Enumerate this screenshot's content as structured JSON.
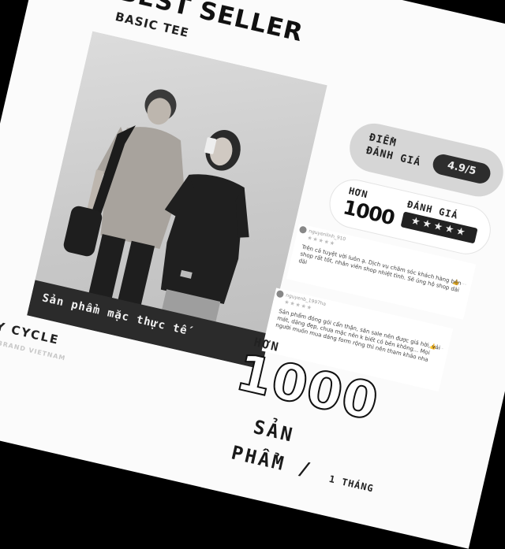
{
  "header": {
    "title": "BEST SELLER",
    "subtitle": "BASIC TEE"
  },
  "photo": {
    "caption": "Sản phẩm mặc thực tế"
  },
  "brand": {
    "name": "CITY CYCLE",
    "tagline": "LOCAL BRAND VIETNAM"
  },
  "rating": {
    "label_line1": "ĐIỂM",
    "label_line2": "ĐÁNH GIÁ",
    "score": "4.9/5"
  },
  "reviews_badge": {
    "prefix": "HƠN",
    "count": "1000",
    "label": "ĐÁNH GIÁ",
    "stars": "★★★★★"
  },
  "reviews": [
    {
      "user": "nguyenlinh_910",
      "stars": "★★★★★",
      "text": "Trên cả tuyệt vời luôn ạ. Dịch vụ chăm sóc khách hàng bên shop rất tốt, nhân viên shop nhiệt tình. Sẽ ủng hộ shop dài dài",
      "icons": "👍 ⋯"
    },
    {
      "user": "nguyenb_1997ha",
      "stars": "★★★★★",
      "text": "Sản phẩm đóng gói cẩn thận, săn sale nên được giá hời, vải mát, dáng đẹp, chưa mặc nên k biết có bền không... Mọi người muốn mua dáng form rộng thì nên tham khảo nha",
      "icons": "👍 ⋯"
    }
  ],
  "sales": {
    "prefix": "HƠN",
    "count": "1000",
    "unit_line1": "SẢN",
    "unit_line2": "PHẨM /",
    "period": "1 THÁNG"
  },
  "colors": {
    "background": "#fbfbfb",
    "dark": "#222222",
    "pill_grey": "#d6d6d6"
  }
}
